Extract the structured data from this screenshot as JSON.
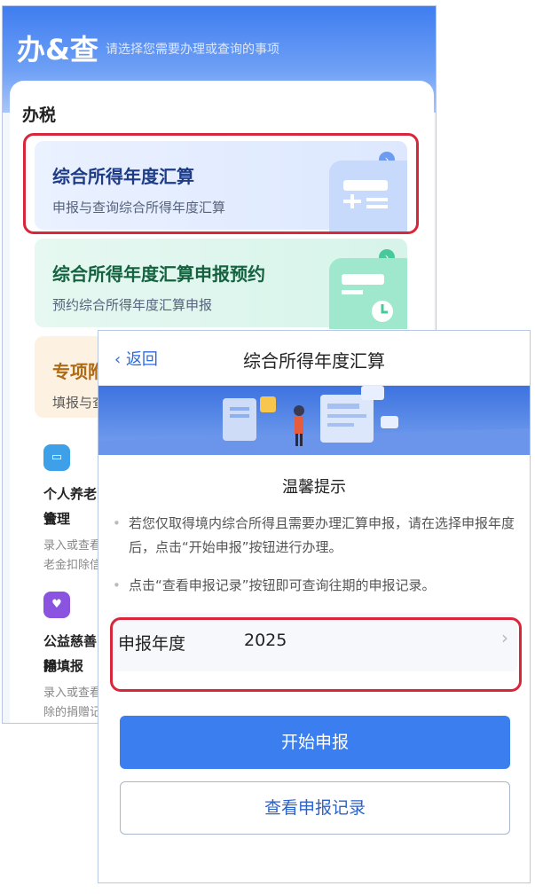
{
  "app": {
    "title": "办&查",
    "subtitle": "请选择您需要办理或查询的事项"
  },
  "section": {
    "title": "办税"
  },
  "cards": [
    {
      "title": "综合所得年度汇算",
      "subtitle": "申报与查询综合所得年度汇算",
      "arrow": "›"
    },
    {
      "title": "综合所得年度汇算申报预约",
      "subtitle": "预约综合所得年度汇算申报",
      "arrow": "›"
    },
    {
      "title": "专项附",
      "subtitle": "填报与查"
    }
  ],
  "tools": [
    {
      "name_line1": "个人养老金",
      "name_line2": "管理",
      "desc_line1": "录入或查看",
      "desc_line2": "老金扣除信"
    },
    {
      "name_line1": "公益慈善捐",
      "name_line2": "除填报",
      "desc_line1": "录入或查看",
      "desc_line2": "除的捐赠记"
    }
  ],
  "modal": {
    "back_label": "返回",
    "title": "综合所得年度汇算",
    "tip_title": "温馨提示",
    "tips": [
      "若您仅取得境内综合所得且需要办理汇算申报，请在选择申报年度后，点击“开始申报”按钮进行办理。",
      "点击“查看申报记录”按钮即可查询往期的申报记录。"
    ],
    "year_label": "申报年度",
    "year_value": "2025",
    "start_button": "开始申报",
    "history_button": "查看申报记录"
  },
  "colors": {
    "primary": "#3a7ef0",
    "highlight": "#d8263b"
  }
}
